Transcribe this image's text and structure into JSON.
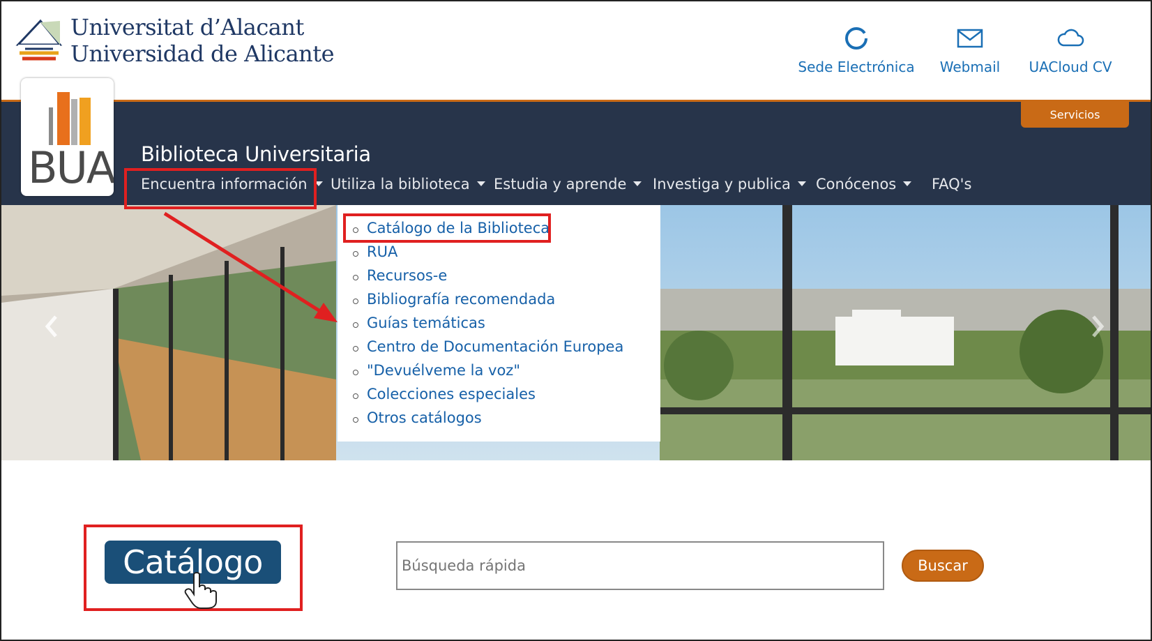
{
  "header": {
    "uni_name_line1": "Universitat d’Alacant",
    "uni_name_line2": "Universidad de Alicante",
    "links": [
      {
        "label": "Sede Electrónica",
        "icon": "sede-ring-icon"
      },
      {
        "label": "Webmail",
        "icon": "mail-icon"
      },
      {
        "label": "UACloud CV",
        "icon": "cloud-icon"
      }
    ]
  },
  "band": {
    "servicios_label": "Servicios",
    "logo_text": "BUA",
    "site_title": "Biblioteca Universitaria",
    "menu": [
      {
        "label": "Encuentra información",
        "has_caret": true
      },
      {
        "label": "Utiliza la biblioteca",
        "has_caret": true
      },
      {
        "label": "Estudia y aprende",
        "has_caret": true
      },
      {
        "label": "Investiga y publica",
        "has_caret": true
      },
      {
        "label": "Conócenos",
        "has_caret": true
      },
      {
        "label": "FAQ's",
        "has_caret": false
      }
    ]
  },
  "dropdown": {
    "items": [
      "Catálogo de la Biblioteca",
      "RUA",
      "Recursos-e",
      "Bibliografía recomendada",
      "Guías temáticas",
      "Centro de Documentación Europea",
      "\"Devuélveme la voz\"",
      "Colecciones especiales",
      "Otros catálogos"
    ]
  },
  "search": {
    "catalog_button_label": "Catálogo",
    "placeholder": "Búsqueda rápida",
    "button_label": "Buscar"
  },
  "colors": {
    "navy_band": "#27344a",
    "orange_accent": "#c96a16",
    "link_blue": "#1a6fb5",
    "annotation_red": "#e02020"
  }
}
